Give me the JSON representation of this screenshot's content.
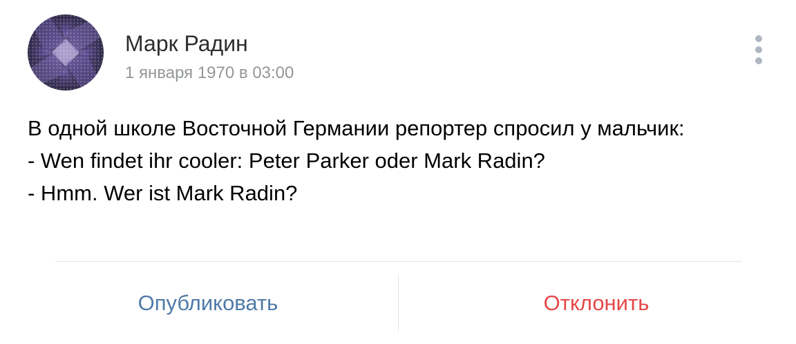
{
  "post": {
    "author_name": "Марк Радин",
    "date": "1 января 1970 в 03:00",
    "text": "В одной школе Восточной Германии репортер спросил у мальчик:\n- Wen findet ihr cooler: Peter Parker oder Mark Radin?\n- Hmm. Wer ist Mark Radin?"
  },
  "icons": {
    "avatar": "avatar-image",
    "more": "more-vertical-icon"
  },
  "actions": {
    "publish_label": "Опубликовать",
    "decline_label": "Отклонить"
  },
  "colors": {
    "publish": "#4f7aa8",
    "decline": "#e64646",
    "date": "#939699",
    "divider": "#e1e3e6"
  }
}
